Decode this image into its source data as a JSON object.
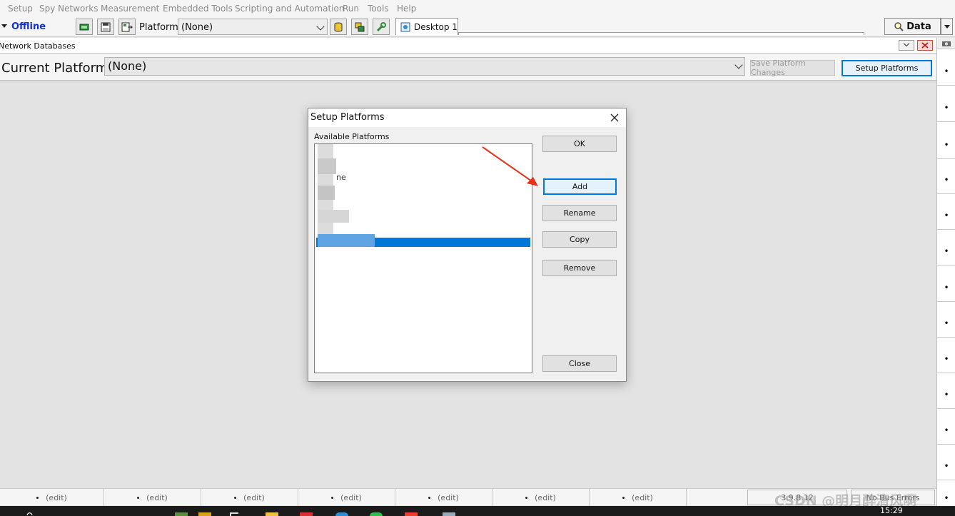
{
  "menu": [
    "Setup",
    "Spy Networks",
    "Measurement",
    "Embedded Tools",
    "Scripting and Automation",
    "Run",
    "Tools",
    "Help"
  ],
  "toolbar": {
    "status": "Offline",
    "platform_label": "Platform:",
    "platform_value": "(None)",
    "desktop_tab": "Desktop 1",
    "data_button": "Data"
  },
  "network_databases": {
    "title": "Network Databases"
  },
  "current_platform": {
    "label": "Current Platform",
    "value": "(None)",
    "save_button": "Save Platform Changes",
    "setup_button": "Setup Platforms"
  },
  "dialog": {
    "title": "Setup Platforms",
    "list_label": "Available Platforms",
    "list_fragments": [
      "ne"
    ],
    "buttons": {
      "ok": "OK",
      "add": "Add",
      "rename": "Rename",
      "copy": "Copy",
      "remove": "Remove",
      "close": "Close"
    }
  },
  "status_bar": {
    "edit_label": "(edit)",
    "version": "3.9.8.12",
    "errors": "No Bus Errors"
  },
  "watermark": "CSDN @明月醉清风啊",
  "taskbar": {
    "time": "15:29"
  },
  "colors": {
    "accent": "#0078d7",
    "offline": "#1033cc",
    "annotation_arrow": "#e8301c"
  }
}
